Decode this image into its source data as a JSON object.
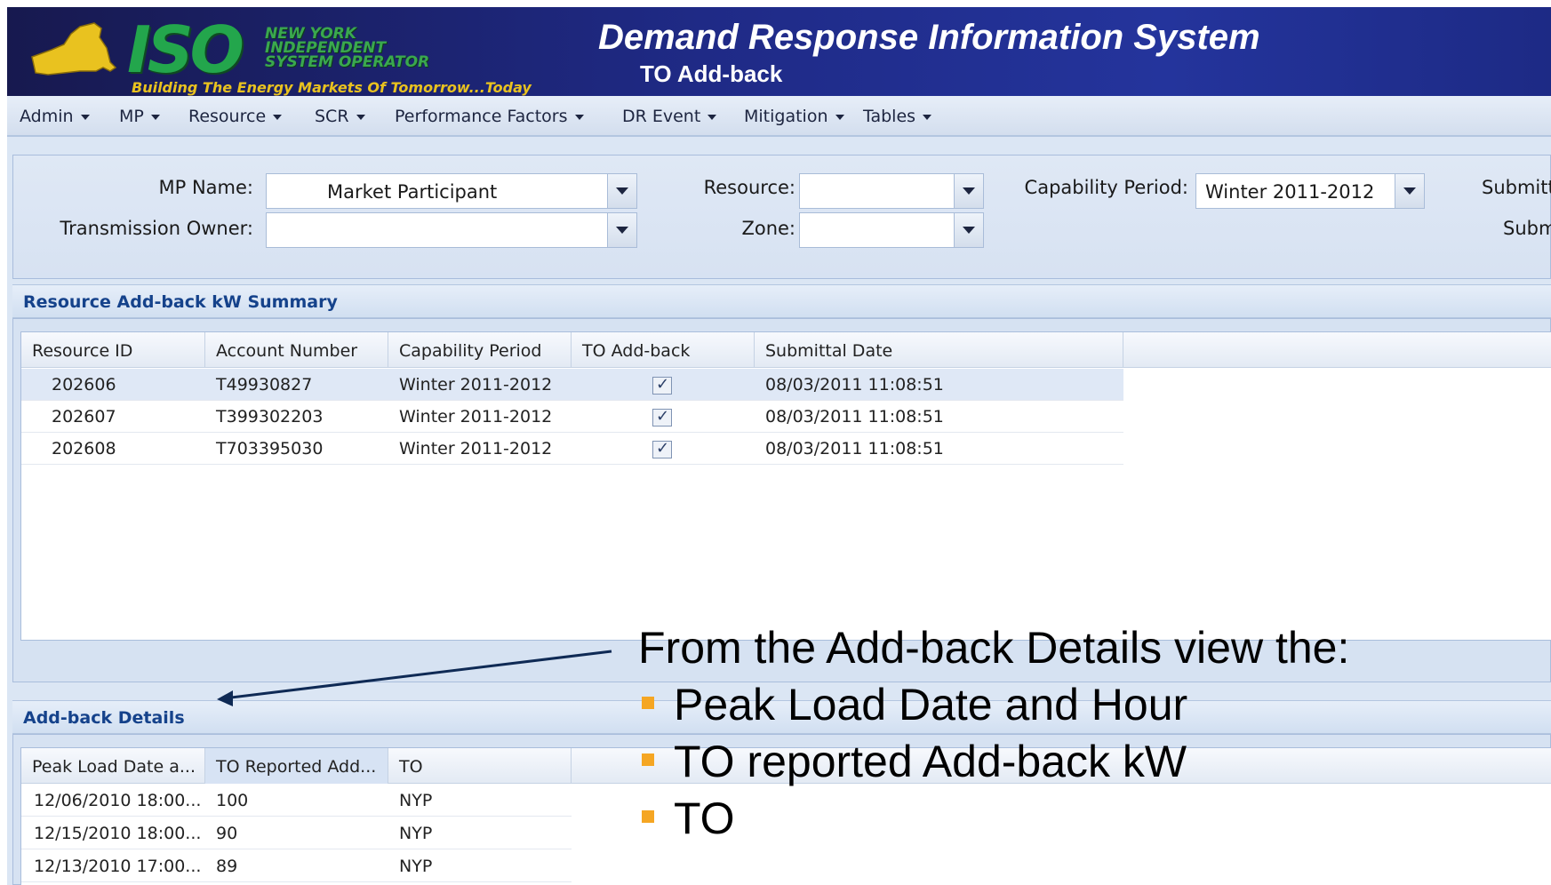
{
  "header": {
    "logo_text": "ISO",
    "logo_org_lines": [
      "NEW YORK",
      "INDEPENDENT",
      "SYSTEM OPERATOR"
    ],
    "logo_tagline": "Building The Energy Markets Of Tomorrow...Today",
    "app_title": "Demand Response Information System",
    "page_subtitle": "TO Add-back"
  },
  "menu": [
    {
      "label": "Admin"
    },
    {
      "label": "MP"
    },
    {
      "label": "Resource"
    },
    {
      "label": "SCR"
    },
    {
      "label": "Performance Factors"
    },
    {
      "label": "DR Event"
    },
    {
      "label": "Mitigation"
    },
    {
      "label": "Tables"
    }
  ],
  "filters": {
    "mp_name": {
      "label": "MP Name:",
      "value": "Market Participant"
    },
    "transmission_owner": {
      "label": "Transmission Owner:",
      "value": ""
    },
    "resource": {
      "label": "Resource:",
      "value": ""
    },
    "zone": {
      "label": "Zone:",
      "value": ""
    },
    "capability_period": {
      "label": "Capability Period:",
      "value": "Winter 2011-2012"
    },
    "submittal_label_1": "Submitt",
    "submittal_label_2": "Subm"
  },
  "summary": {
    "title": "Resource Add-back kW Summary",
    "columns": [
      "Resource ID",
      "Account Number",
      "Capability Period",
      "TO Add-back",
      "Submittal Date"
    ],
    "rows": [
      {
        "resource_id": "202606",
        "account_number": "T49930827",
        "capability_period": "Winter 2011-2012",
        "to_addback": true,
        "submittal_date": "08/03/2011 11:08:51"
      },
      {
        "resource_id": "202607",
        "account_number": "T399302203",
        "capability_period": "Winter 2011-2012",
        "to_addback": true,
        "submittal_date": "08/03/2011 11:08:51"
      },
      {
        "resource_id": "202608",
        "account_number": "T703395030",
        "capability_period": "Winter 2011-2012",
        "to_addback": true,
        "submittal_date": "08/03/2011 11:08:51"
      }
    ]
  },
  "details": {
    "title": "Add-back Details",
    "columns": [
      "Peak Load Date a...",
      "TO Reported Add...",
      "TO"
    ],
    "rows": [
      {
        "peak_load": "12/06/2010 18:00...",
        "to_reported": "100",
        "to": "NYP"
      },
      {
        "peak_load": "12/15/2010 18:00...",
        "to_reported": "90",
        "to": "NYP"
      },
      {
        "peak_load": "12/13/2010 17:00...",
        "to_reported": "89",
        "to": "NYP"
      }
    ]
  },
  "callout": {
    "heading": "From the Add-back Details view the:",
    "bullets": [
      "Peak Load Date and Hour",
      "TO reported Add-back kW",
      "TO"
    ],
    "bullet_color": "#f5a623"
  }
}
